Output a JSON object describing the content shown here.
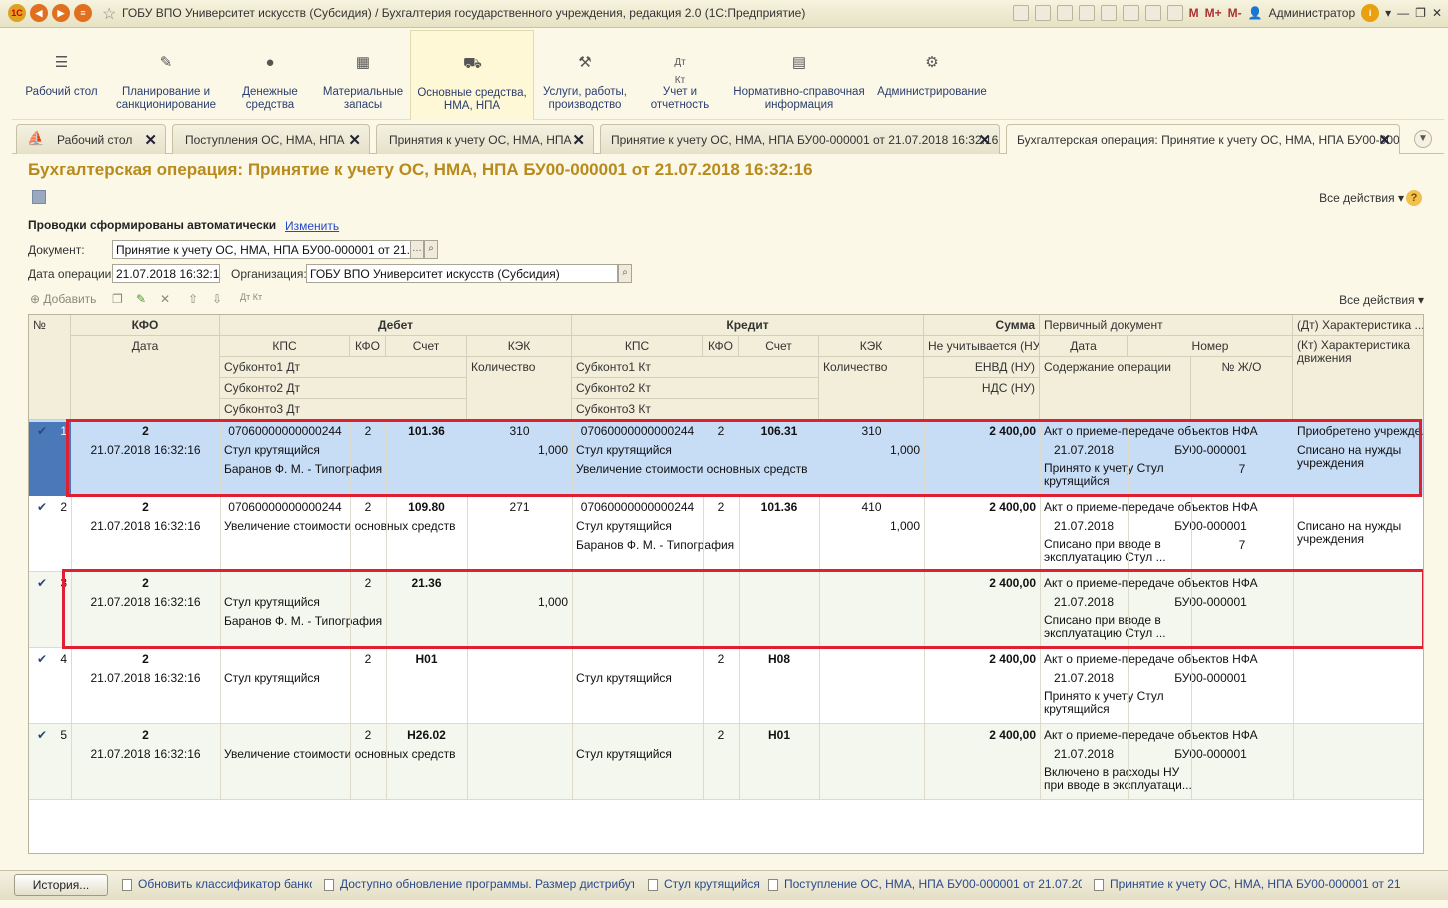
{
  "window": {
    "title": "ГОБУ ВПО Университет искусств (Субсидия) / Бухгалтерия государственного учреждения, редакция 2.0  (1С:Предприятие)",
    "user": "Администратор",
    "m_labels": [
      "M",
      "M+",
      "M-"
    ]
  },
  "sections": [
    {
      "label": "Рабочий стол",
      "icon": "menu-icon"
    },
    {
      "label": "Планирование и санкционирование",
      "icon": "planning-icon"
    },
    {
      "label": "Денежные средства",
      "icon": "money-icon"
    },
    {
      "label": "Материальные запасы",
      "icon": "grid-icon"
    },
    {
      "label": "Основные средства, НМА, НПА",
      "icon": "truck-icon"
    },
    {
      "label": "Услуги, работы, производство",
      "icon": "tools-icon"
    },
    {
      "label": "Учет и отчетность",
      "icon": "dt-kt-icon"
    },
    {
      "label": "Нормативно-справочная информация",
      "icon": "book-icon"
    },
    {
      "label": "Администрирование",
      "icon": "gear-icon"
    }
  ],
  "tabs": [
    {
      "label": "Рабочий стол"
    },
    {
      "label": "Поступления ОС, НМА, НПА"
    },
    {
      "label": "Принятия к учету ОС, НМА, НПА"
    },
    {
      "label": "Принятие к учету ОС, НМА, НПА БУ00-000001 от 21.07.2018 16:32:16"
    },
    {
      "label": "Бухгалтерская операция: Принятие к учету ОС, НМА, НПА БУ00-000..."
    }
  ],
  "doc": {
    "title": "Бухгалтерская операция: Принятие к учету ОС, НМА, НПА БУ00-000001 от 21.07.2018 16:32:16",
    "all_actions": "Все действия",
    "prov_label": "Проводки сформированы автоматически",
    "prov_link": "Изменить",
    "document_label": "Документ:",
    "document_value": "Принятие к учету ОС, НМА, НПА БУ00-000001 от 21.07.20",
    "date_label": "Дата операции:",
    "date_value": "21.07.2018 16:32:16",
    "org_label": "Организация:",
    "org_value": "ГОБУ ВПО Университет искусств (Субсидия)",
    "add_label": "Добавить",
    "all_actions2": "Все действия"
  },
  "headers": {
    "num": "№",
    "kfo": "КФО",
    "date": "Дата",
    "debet": "Дебет",
    "kredit": "Кредит",
    "kps": "КПС",
    "kfo2": "КФО",
    "schet": "Счет",
    "kek": "КЭК",
    "qty": "Количество",
    "sub1dt": "Субконто1 Дт",
    "sub2dt": "Субконто2 Дт",
    "sub3dt": "Субконто3 Дт",
    "sub1kt": "Субконто1 Кт",
    "sub2kt": "Субконто2 Кт",
    "sub3kt": "Субконто3 Кт",
    "summa": "Сумма",
    "ne_uchit": "Не учитывается (НУ)",
    "envd": "ЕНВД (НУ)",
    "nds": "НДС (НУ)",
    "perv": "Первичный документ",
    "pdate": "Дата",
    "nomer": "Номер",
    "soderzh": "Содержание операции",
    "zho": "№ Ж/О",
    "dt_har": "(Дт) Характеристика ...",
    "kt_har": "(Кт) Характеристика движения"
  },
  "rows": [
    {
      "n": "1",
      "kfo": "2",
      "date": "21.07.2018 16:32:16",
      "dt_kps": "07060000000000244",
      "dt_kfo": "2",
      "dt_schet": "101.36",
      "dt_kek": "310",
      "dt_s1": "Стул крутящийся",
      "dt_qty": "1,000",
      "dt_s2": "Баранов Ф. М. - Типография",
      "kt_kps": "07060000000000244",
      "kt_kfo": "2",
      "kt_schet": "106.31",
      "kt_kek": "310",
      "kt_s1": "Стул крутящийся",
      "kt_qty": "1,000",
      "kt_s2": "Увеличение стоимости основных средств",
      "sum": "2 400,00",
      "perv": "Акт о приеме-передаче объектов НФА",
      "pdate": "21.07.2018",
      "nomer": "БУ00-000001",
      "soderzh1": "Принято к учету Стул",
      "soderzh2": "крутящийся",
      "zho": "7",
      "har1": "Приобретено учрежде...",
      "har2": "Списано на нужды",
      "har3": "учреждения"
    },
    {
      "n": "2",
      "kfo": "2",
      "date": "21.07.2018 16:32:16",
      "dt_kps": "07060000000000244",
      "dt_kfo": "2",
      "dt_schet": "109.80",
      "dt_kek": "271",
      "dt_s1": "Увеличение стоимости основных средств",
      "dt_qty": "",
      "dt_s2": "",
      "kt_kps": "07060000000000244",
      "kt_kfo": "2",
      "kt_schet": "101.36",
      "kt_kek": "410",
      "kt_s1": "Стул крутящийся",
      "kt_qty": "1,000",
      "kt_s2": "Баранов Ф. М. - Типография",
      "sum": "2 400,00",
      "perv": "Акт о приеме-передаче объектов НФА",
      "pdate": "21.07.2018",
      "nomer": "БУ00-000001",
      "soderzh1": "Списано при вводе в",
      "soderzh2": "эксплуатацию Стул ...",
      "zho": "7",
      "har1": "",
      "har2": "Списано на нужды",
      "har3": "учреждения"
    },
    {
      "n": "3",
      "kfo": "2",
      "date": "21.07.2018 16:32:16",
      "dt_kps": "",
      "dt_kfo": "2",
      "dt_schet": "21.36",
      "dt_kek": "",
      "dt_s1": "Стул крутящийся",
      "dt_qty": "1,000",
      "dt_s2": "Баранов Ф. М. - Типография",
      "kt_kps": "",
      "kt_kfo": "",
      "kt_schet": "",
      "kt_kek": "",
      "kt_s1": "",
      "kt_qty": "",
      "kt_s2": "",
      "sum": "2 400,00",
      "perv": "Акт о приеме-передаче объектов НФА",
      "pdate": "21.07.2018",
      "nomer": "БУ00-000001",
      "soderzh1": "Списано при вводе в",
      "soderzh2": "эксплуатацию Стул ...",
      "zho": "",
      "har1": "",
      "har2": "",
      "har3": ""
    },
    {
      "n": "4",
      "kfo": "2",
      "date": "21.07.2018 16:32:16",
      "dt_kps": "",
      "dt_kfo": "2",
      "dt_schet": "Н01",
      "dt_kek": "",
      "dt_s1": "Стул крутящийся",
      "dt_qty": "",
      "dt_s2": "",
      "kt_kps": "",
      "kt_kfo": "2",
      "kt_schet": "Н08",
      "kt_kek": "",
      "kt_s1": "Стул крутящийся",
      "kt_qty": "",
      "kt_s2": "",
      "sum": "2 400,00",
      "perv": "Акт о приеме-передаче объектов НФА",
      "pdate": "21.07.2018",
      "nomer": "БУ00-000001",
      "soderzh1": "Принято к учету Стул",
      "soderzh2": "крутящийся",
      "zho": "",
      "har1": "",
      "har2": "",
      "har3": ""
    },
    {
      "n": "5",
      "kfo": "2",
      "date": "21.07.2018 16:32:16",
      "dt_kps": "",
      "dt_kfo": "2",
      "dt_schet": "Н26.02",
      "dt_kek": "",
      "dt_s1": "Увеличение стоимости основных средств",
      "dt_qty": "",
      "dt_s2": "",
      "kt_kps": "",
      "kt_kfo": "2",
      "kt_schet": "Н01",
      "kt_kek": "",
      "kt_s1": "Стул крутящийся",
      "kt_qty": "",
      "kt_s2": "",
      "sum": "2 400,00",
      "perv": "Акт о приеме-передаче объектов НФА",
      "pdate": "21.07.2018",
      "nomer": "БУ00-000001",
      "soderzh1": "Включено в расходы НУ",
      "soderzh2": "при вводе в эксплуатаци...",
      "zho": "",
      "har1": "",
      "har2": "",
      "har3": ""
    }
  ],
  "status": {
    "history": "История...",
    "notifications": [
      "Обновить классификатор банков",
      "Доступно обновление программы. Размер дистрибут...",
      "Стул крутящийся",
      "Поступление ОС, НМА, НПА БУ00-000001 от 21.07.201...",
      "Принятие к учету ОС, НМА, НПА БУ00-000001 от 21.07..."
    ]
  },
  "colors": {
    "accent_title": "#b88a1b",
    "selection": "#c7dcf5",
    "highlight_box": "#e02030"
  }
}
